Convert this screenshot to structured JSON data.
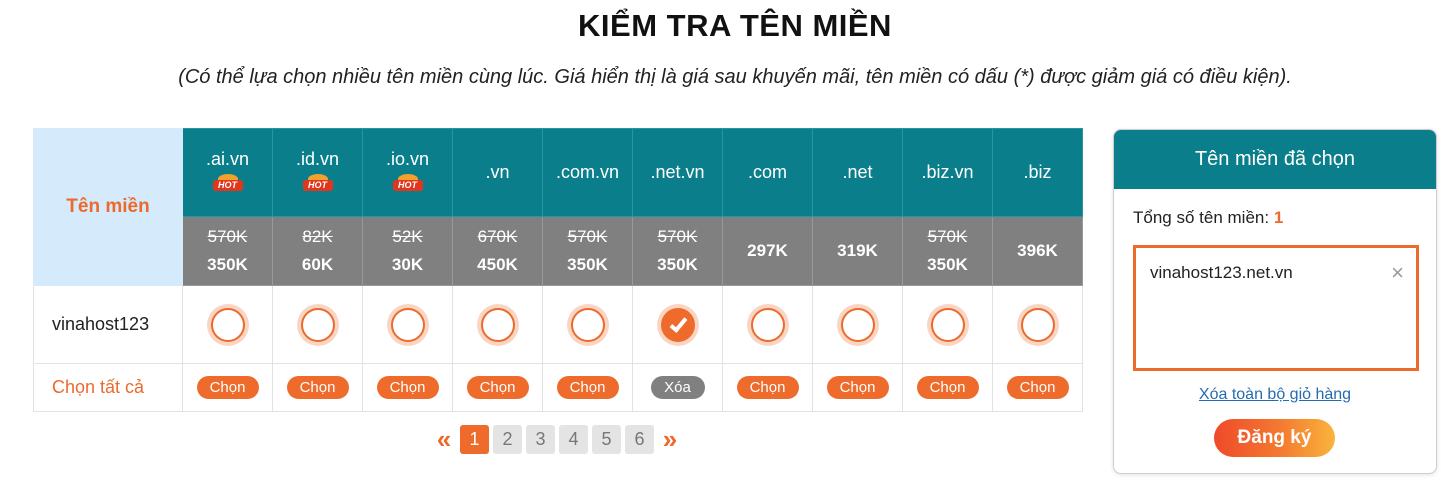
{
  "header": {
    "title": "KIỂM TRA TÊN MIỀN",
    "subtitle": "(Có thể lựa chọn nhiều tên miền cùng lúc. Giá hiển thị là giá sau khuyến mãi, tên miền có dấu (*) được giảm giá có điều kiện)."
  },
  "table": {
    "name_header": "Tên miền",
    "domain_name": "vinahost123",
    "select_all_label": "Chọn tất cả",
    "extensions": [
      {
        "ext": ".ai.vn",
        "hot": true,
        "old_price": "570K",
        "price": "350K",
        "checked": false,
        "action": "Chọn"
      },
      {
        "ext": ".id.vn",
        "hot": true,
        "old_price": "82K",
        "price": "60K",
        "checked": false,
        "action": "Chọn"
      },
      {
        "ext": ".io.vn",
        "hot": true,
        "old_price": "52K",
        "price": "30K",
        "checked": false,
        "action": "Chọn"
      },
      {
        "ext": ".vn",
        "hot": false,
        "old_price": "670K",
        "price": "450K",
        "checked": false,
        "action": "Chọn"
      },
      {
        "ext": ".com.vn",
        "hot": false,
        "old_price": "570K",
        "price": "350K",
        "checked": false,
        "action": "Chọn"
      },
      {
        "ext": ".net.vn",
        "hot": false,
        "old_price": "570K",
        "price": "350K",
        "checked": true,
        "action": "Xóa"
      },
      {
        "ext": ".com",
        "hot": false,
        "old_price": "",
        "price": "297K",
        "checked": false,
        "action": "Chọn"
      },
      {
        "ext": ".net",
        "hot": false,
        "old_price": "",
        "price": "319K",
        "checked": false,
        "action": "Chọn"
      },
      {
        "ext": ".biz.vn",
        "hot": false,
        "old_price": "570K",
        "price": "350K",
        "checked": false,
        "action": "Chọn"
      },
      {
        "ext": ".biz",
        "hot": false,
        "old_price": "",
        "price": "396K",
        "checked": false,
        "action": "Chọn"
      }
    ],
    "hot_badge": "HOT"
  },
  "pagination": {
    "prev": "«",
    "next": "»",
    "pages": [
      "1",
      "2",
      "3",
      "4",
      "5",
      "6"
    ],
    "current": "1"
  },
  "cart": {
    "title": "Tên miền đã chọn",
    "count_label": "Tổng số tên miền:",
    "count": "1",
    "items": [
      "vinahost123.net.vn"
    ],
    "remove_icon": "×",
    "clear_label": "Xóa toàn bộ giỏ hàng",
    "register_label": "Đăng ký"
  },
  "colors": {
    "teal": "#0b7e8c",
    "orange": "#ee6b2c",
    "gray": "#808080",
    "light_blue": "#d5ebfb"
  }
}
